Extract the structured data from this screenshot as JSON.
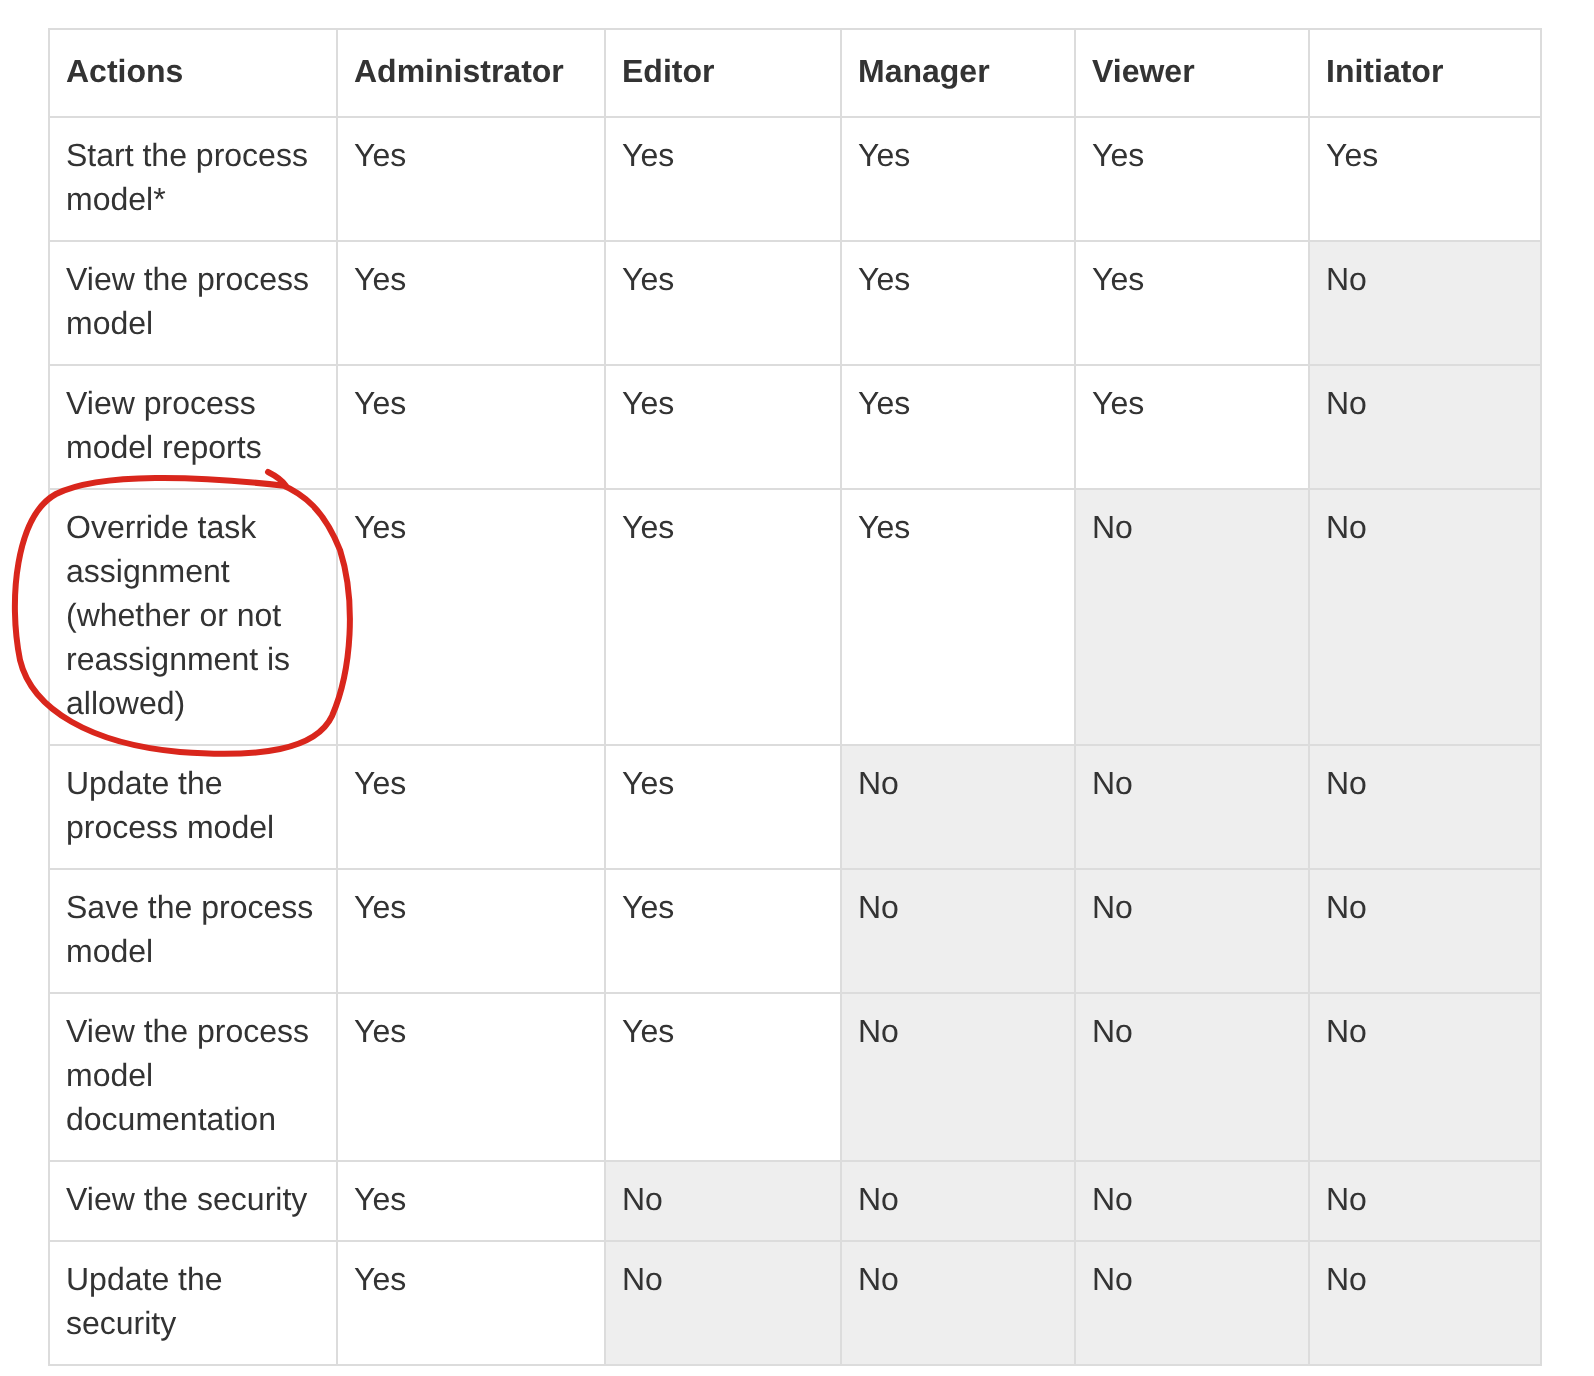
{
  "table": {
    "columns": [
      "Actions",
      "Administrator",
      "Editor",
      "Manager",
      "Viewer",
      "Initiator"
    ],
    "rows": [
      {
        "cells": [
          {
            "value": "Start the process model*",
            "shaded": false
          },
          {
            "value": "Yes",
            "shaded": false
          },
          {
            "value": "Yes",
            "shaded": false
          },
          {
            "value": "Yes",
            "shaded": false
          },
          {
            "value": "Yes",
            "shaded": false
          },
          {
            "value": "Yes",
            "shaded": false
          }
        ]
      },
      {
        "cells": [
          {
            "value": "View the process model",
            "shaded": false
          },
          {
            "value": "Yes",
            "shaded": false
          },
          {
            "value": "Yes",
            "shaded": false
          },
          {
            "value": "Yes",
            "shaded": false
          },
          {
            "value": "Yes",
            "shaded": false
          },
          {
            "value": "No",
            "shaded": true
          }
        ]
      },
      {
        "cells": [
          {
            "value": "View process model reports",
            "shaded": false
          },
          {
            "value": "Yes",
            "shaded": false
          },
          {
            "value": "Yes",
            "shaded": false
          },
          {
            "value": "Yes",
            "shaded": false
          },
          {
            "value": "Yes",
            "shaded": false
          },
          {
            "value": "No",
            "shaded": true
          }
        ]
      },
      {
        "cells": [
          {
            "value": "Override task assignment (whether or not reassignment is allowed)",
            "shaded": false
          },
          {
            "value": "Yes",
            "shaded": false
          },
          {
            "value": "Yes",
            "shaded": false
          },
          {
            "value": "Yes",
            "shaded": false
          },
          {
            "value": "No",
            "shaded": true
          },
          {
            "value": "No",
            "shaded": true
          }
        ]
      },
      {
        "cells": [
          {
            "value": "Update the process model",
            "shaded": false
          },
          {
            "value": "Yes",
            "shaded": false
          },
          {
            "value": "Yes",
            "shaded": false
          },
          {
            "value": "No",
            "shaded": true
          },
          {
            "value": "No",
            "shaded": true
          },
          {
            "value": "No",
            "shaded": true
          }
        ]
      },
      {
        "cells": [
          {
            "value": "Save the process model",
            "shaded": false
          },
          {
            "value": "Yes",
            "shaded": false
          },
          {
            "value": "Yes",
            "shaded": false
          },
          {
            "value": "No",
            "shaded": true
          },
          {
            "value": "No",
            "shaded": true
          },
          {
            "value": "No",
            "shaded": true
          }
        ]
      },
      {
        "cells": [
          {
            "value": "View the process model documentation",
            "shaded": false
          },
          {
            "value": "Yes",
            "shaded": false
          },
          {
            "value": "Yes",
            "shaded": false
          },
          {
            "value": "No",
            "shaded": true
          },
          {
            "value": "No",
            "shaded": true
          },
          {
            "value": "No",
            "shaded": true
          }
        ]
      },
      {
        "cells": [
          {
            "value": "View the security",
            "shaded": false
          },
          {
            "value": "Yes",
            "shaded": false
          },
          {
            "value": "No",
            "shaded": true
          },
          {
            "value": "No",
            "shaded": true
          },
          {
            "value": "No",
            "shaded": true
          },
          {
            "value": "No",
            "shaded": true
          }
        ]
      },
      {
        "cells": [
          {
            "value": "Update the security",
            "shaded": false
          },
          {
            "value": "Yes",
            "shaded": false
          },
          {
            "value": "No",
            "shaded": true
          },
          {
            "value": "No",
            "shaded": true
          },
          {
            "value": "No",
            "shaded": true
          },
          {
            "value": "No",
            "shaded": true
          }
        ]
      }
    ]
  }
}
